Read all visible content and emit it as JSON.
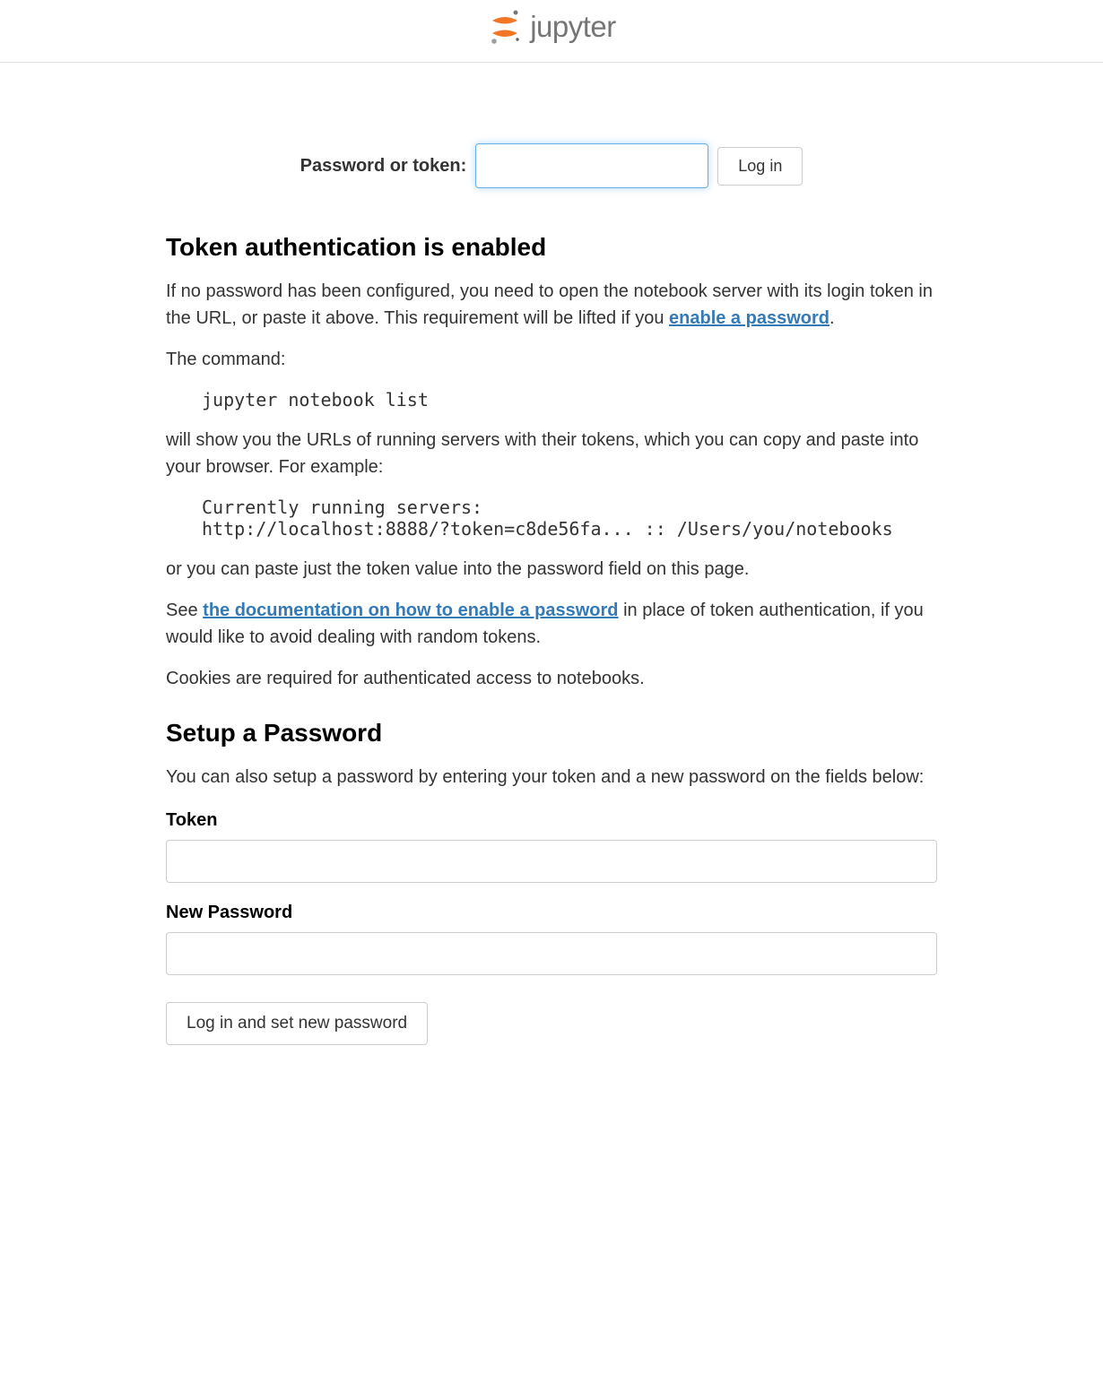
{
  "brand": "jupyter",
  "login": {
    "label": "Password or token:",
    "button": "Log in"
  },
  "section1": {
    "heading": "Token authentication is enabled",
    "p1_a": "If no password has been configured, you need to open the notebook server with its login token in the URL, or paste it above. This requirement will be lifted if you ",
    "p1_link": "enable a password",
    "p1_b": ".",
    "p2": "The command:",
    "code1": "jupyter notebook list",
    "p3": "will show you the URLs of running servers with their tokens, which you can copy and paste into your browser. For example:",
    "code2": "Currently running servers:\nhttp://localhost:8888/?token=c8de56fa... :: /Users/you/notebooks",
    "p4": "or you can paste just the token value into the password field on this page.",
    "p5_a": "See ",
    "p5_link": "the documentation on how to enable a password",
    "p5_b": " in place of token authentication, if you would like to avoid dealing with random tokens.",
    "p6": "Cookies are required for authenticated access to notebooks."
  },
  "section2": {
    "heading": "Setup a Password",
    "p1": "You can also setup a password by entering your token and a new password on the fields below:",
    "token_label": "Token",
    "newpw_label": "New Password",
    "submit": "Log in and set new password"
  }
}
